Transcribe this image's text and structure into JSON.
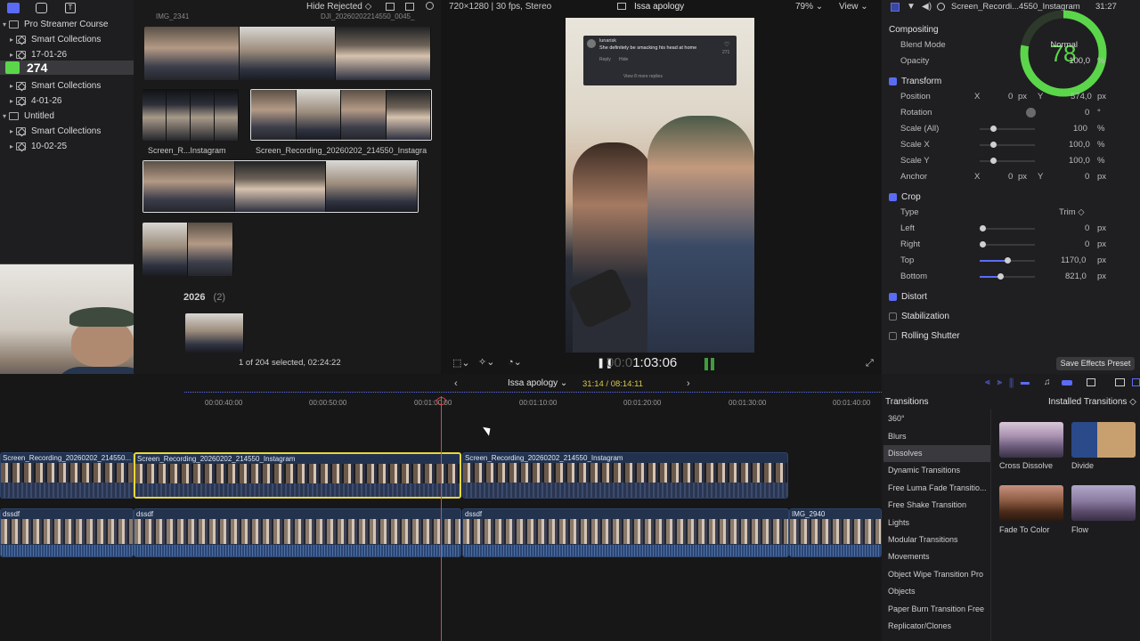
{
  "library": {
    "items": [
      {
        "label": "Pro Streamer Course",
        "level": 0,
        "kind": "library"
      },
      {
        "label": "Smart Collections",
        "level": 1,
        "kind": "smart"
      },
      {
        "label": "17-01-26",
        "level": 1,
        "kind": "event"
      },
      {
        "label": "274",
        "level": 0,
        "kind": "overlay"
      },
      {
        "label": "Smart Collections",
        "level": 1,
        "kind": "smart"
      },
      {
        "label": "4-01-26",
        "level": 1,
        "kind": "event"
      },
      {
        "label": "Untitled",
        "level": 0,
        "kind": "library"
      },
      {
        "label": "Smart Collections",
        "level": 1,
        "kind": "smart"
      },
      {
        "label": "10-02-25",
        "level": 1,
        "kind": "event"
      }
    ]
  },
  "browser": {
    "filter": "Hide Rejected",
    "top_clip_names": [
      "IMG_2341",
      "DJI_20260202214550_0045_"
    ],
    "clip_labels": [
      "Screen_R...Instagram",
      "Screen_Recording_20260202_214550_Instagra"
    ],
    "group_year": "2026",
    "group_count": "(2)",
    "selection_status": "1 of 204 selected, 02:24:22"
  },
  "viewer": {
    "format": "720×1280 | 30 fps, Stereo",
    "project_name": "Issa apology",
    "zoom": "79%",
    "view_menu": "View",
    "timecode": "1:03:06",
    "timecode_dim": "00:0",
    "comment_user": "lunarisk",
    "comment_text": "She definitely be smacking his head at home",
    "comment_reply": "Reply",
    "comment_hide": "Hide",
    "comment_more": "View 8 more replies",
    "comment_likes": "271"
  },
  "inspector": {
    "title": "Screen_Recordi...4550_Instagram",
    "clock": "31:27",
    "sections": {
      "compositing": "Compositing",
      "transform": "Transform",
      "crop": "Crop",
      "distort": "Distort",
      "stabilization": "Stabilization",
      "rolling_shutter": "Rolling Shutter"
    },
    "blend_mode_label": "Blend Mode",
    "blend_mode_value": "Normal",
    "opacity_label": "Opacity",
    "opacity_value": "100,0",
    "opacity_unit": "%",
    "position_label": "Position",
    "position_x": "0",
    "position_y": "574,0",
    "rotation_label": "Rotation",
    "rotation_value": "0",
    "rotation_unit": "°",
    "scale_all_label": "Scale (All)",
    "scale_all_value": "100",
    "scale_x_label": "Scale X",
    "scale_x_value": "100,0",
    "scale_y_label": "Scale Y",
    "scale_y_value": "100,0",
    "anchor_label": "Anchor",
    "anchor_x": "0",
    "anchor_y": "0",
    "type_label": "Type",
    "type_value": "Trim",
    "left_label": "Left",
    "left_value": "0",
    "right_label": "Right",
    "right_value": "0",
    "top_label": "Top",
    "top_value": "1170,0",
    "bottom_label": "Bottom",
    "bottom_value": "821,0",
    "px": "px",
    "x": "X",
    "y": "Y",
    "save_preset": "Save Effects Preset",
    "score": "78"
  },
  "timeline": {
    "project": "Issa apology",
    "duration": "31:14 / 08:14:11",
    "ruler": [
      "00:00:40:00",
      "00:00:50:00",
      "00:01:00:00",
      "00:01:10:00",
      "00:01:20:00",
      "00:01:30:00",
      "00:01:40:00"
    ],
    "video_clips": [
      "Screen_Recording_20260202_214550...",
      "Screen_Recording_20260202_214550_Instagram",
      "Screen_Recording_20260202_214550_Instagram"
    ],
    "audio_clips": [
      "dssdf",
      "dssdf",
      "dssdf",
      "IMG_2940"
    ]
  },
  "transitions": {
    "header": "Transitions",
    "installed": "Installed Transitions",
    "categories": [
      "360°",
      "Blurs",
      "Dissolves",
      "Dynamic Transitions",
      "Free Luma Fade Transitio...",
      "Free Shake Transition",
      "Lights",
      "Modular Transitions",
      "Movements",
      "Object Wipe Transition Pro",
      "Objects",
      "Paper Burn Transition Free",
      "Replicator/Clones"
    ],
    "selected_index": 2,
    "items": [
      "Cross Dissolve",
      "Divide",
      "Fade To Color",
      "Flow"
    ]
  },
  "colors": {
    "accent": "#5a6cf5",
    "selection": "#e8d73a",
    "playhead": "#d94a45",
    "score_green": "#5bd64a"
  }
}
